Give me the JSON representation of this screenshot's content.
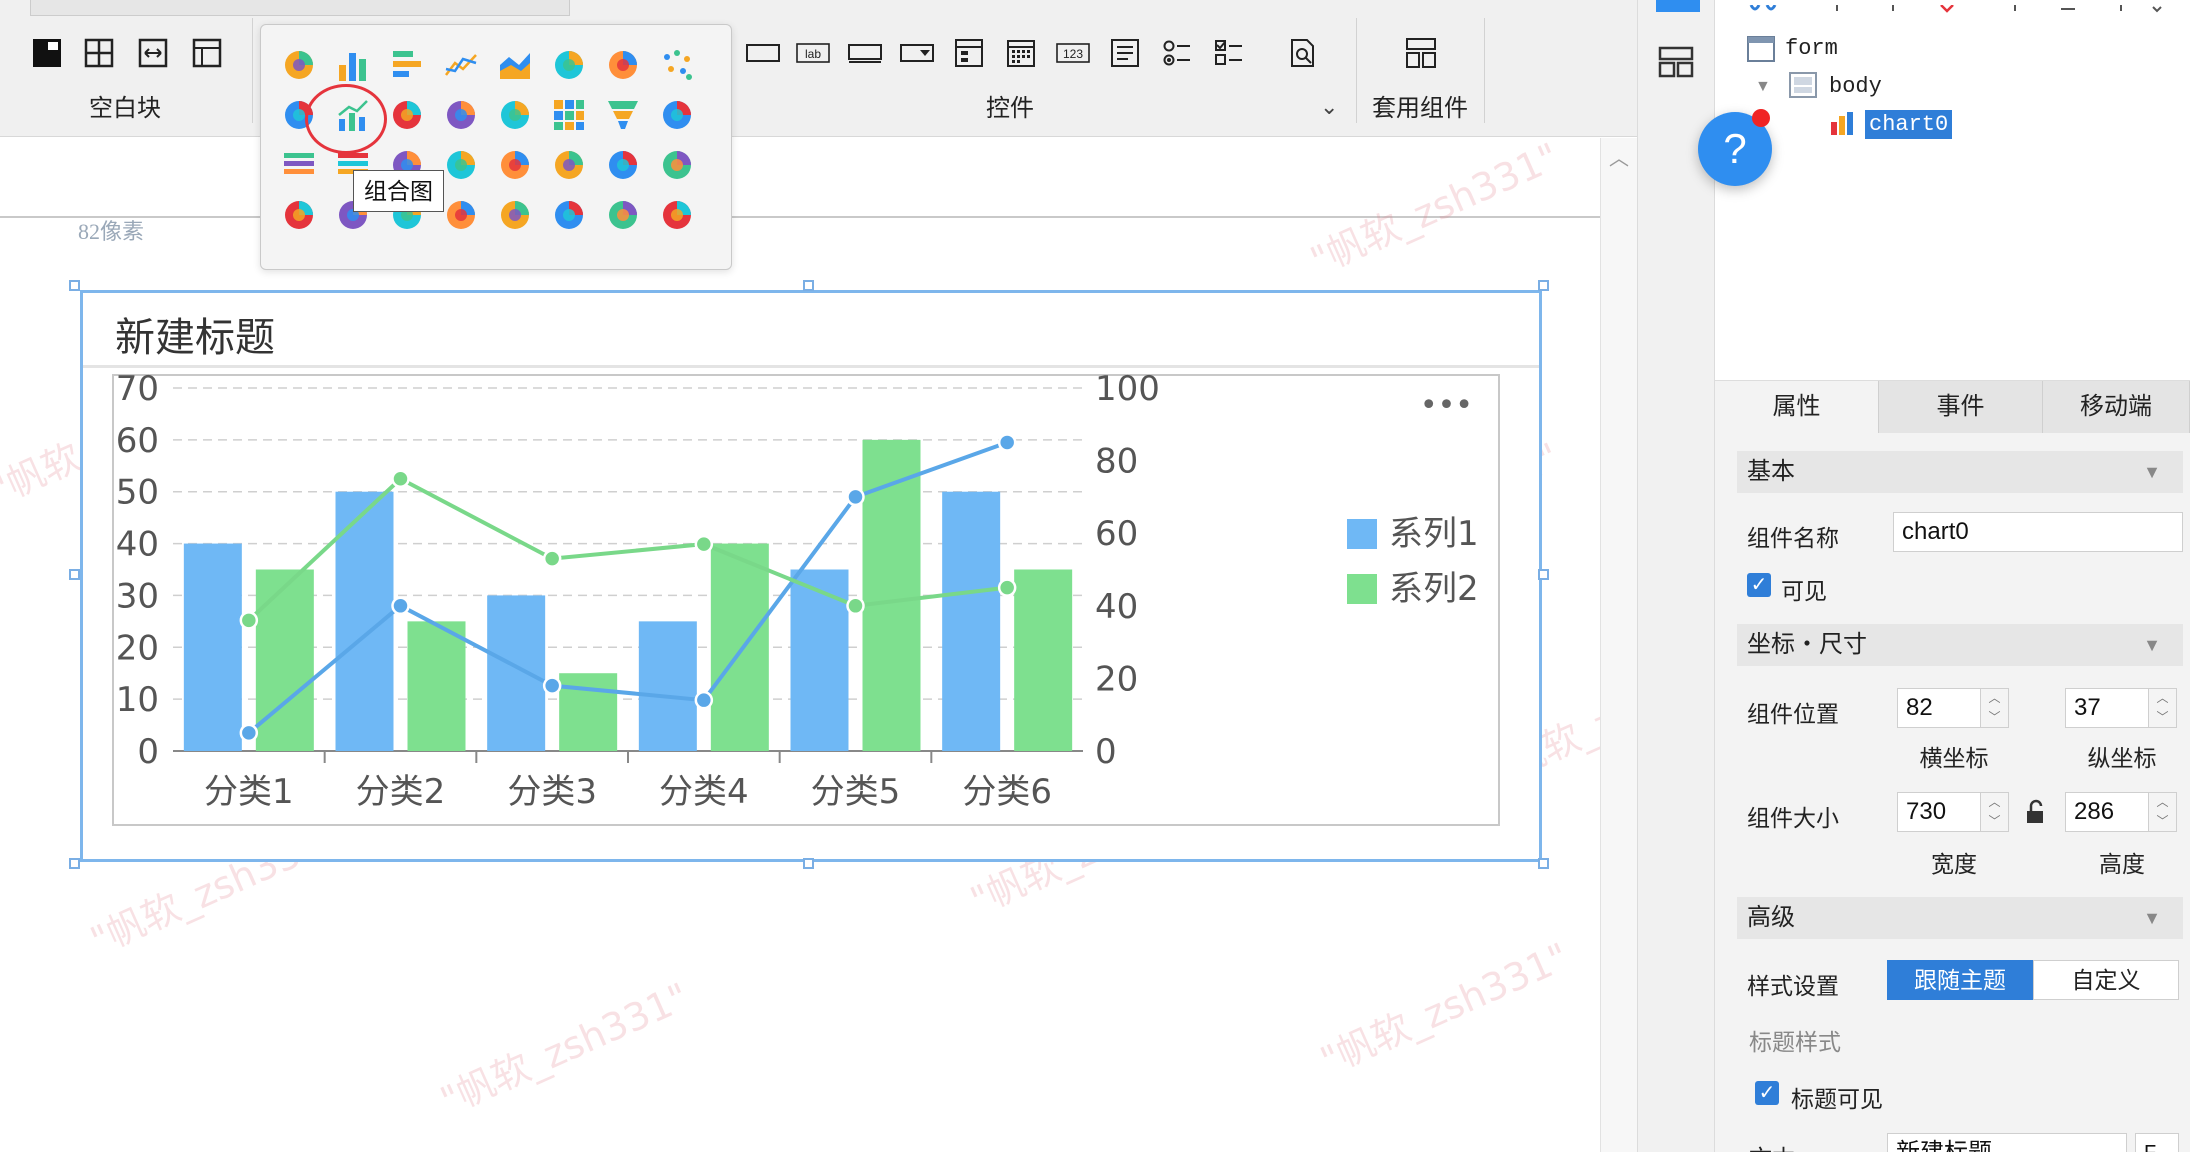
{
  "toolbar": {
    "group_blank_label": "空白块",
    "group_controls_label": "控件",
    "group_templates_label": "套用组件",
    "input_label_text": "lab",
    "number_icon_text": "123"
  },
  "palette": {
    "tooltip": "组合图"
  },
  "canvas": {
    "px_label": "82像素",
    "watermark_text": "\"帆软_zsh331\""
  },
  "chart_data": {
    "type": "bar",
    "title": "新建标题",
    "categories": [
      "分类1",
      "分类2",
      "分类3",
      "分类4",
      "分类5",
      "分类6"
    ],
    "series": [
      {
        "name": "系列1",
        "kind": "bar",
        "axis": "left",
        "color": "#6fb8f5",
        "values": [
          40,
          50,
          30,
          25,
          35,
          50
        ]
      },
      {
        "name": "系列2",
        "kind": "bar",
        "axis": "left",
        "color": "#7ee08f",
        "values": [
          35,
          25,
          15,
          40,
          60,
          35
        ]
      },
      {
        "kind": "line",
        "axis": "right",
        "color": "#5aa7e8",
        "values": [
          5,
          40,
          18,
          14,
          70,
          85
        ]
      },
      {
        "kind": "line",
        "axis": "right",
        "color": "#79d889",
        "values": [
          36,
          75,
          53,
          57,
          40,
          45
        ]
      }
    ],
    "y_left_ticks": [
      "70",
      "60",
      "50",
      "40",
      "30",
      "20",
      "10",
      "0"
    ],
    "y_right_ticks": [
      "100",
      "80",
      "60",
      "40",
      "20",
      "0"
    ],
    "ylim_left": [
      0,
      70
    ],
    "ylim_right": [
      0,
      100
    ],
    "grid": true,
    "legend_position": "right",
    "more_glyph": "•••"
  },
  "tree": {
    "form": "form",
    "body": "body",
    "chart0": "chart0"
  },
  "props": {
    "tabs": [
      "属性",
      "事件",
      "移动端"
    ],
    "section_basic": "基本",
    "name_label": "组件名称",
    "name_value": "chart0",
    "visible_label": "可见",
    "section_coords": "坐标・尺寸",
    "position_label": "组件位置",
    "pos_x": "82",
    "pos_y": "37",
    "x_caption": "横坐标",
    "y_caption": "纵坐标",
    "size_label": "组件大小",
    "width": "730",
    "height": "286",
    "width_caption": "宽度",
    "height_caption": "高度",
    "section_advanced": "高级",
    "style_label": "样式设置",
    "style_follow": "跟随主题",
    "style_custom": "自定义",
    "title_style_label": "标题样式",
    "title_visible_label": "标题可见",
    "text_label": "文本",
    "text_value": "新建标题"
  }
}
